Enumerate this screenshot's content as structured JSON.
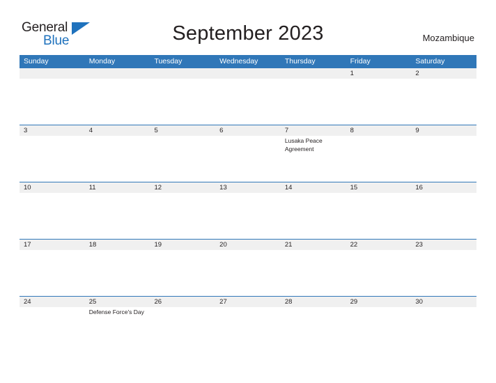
{
  "brand": {
    "name_part1": "General",
    "name_part2": "Blue",
    "logo_icon": "triangle-icon",
    "accent_color": "#1f72bd"
  },
  "header": {
    "title": "September 2023",
    "country": "Mozambique"
  },
  "calendar": {
    "header_bg_color": "#3077b8",
    "date_row_bg_color": "#f0f0f0",
    "day_names": [
      "Sunday",
      "Monday",
      "Tuesday",
      "Wednesday",
      "Thursday",
      "Friday",
      "Saturday"
    ],
    "weeks": [
      {
        "dates": [
          "",
          "",
          "",
          "",
          "",
          "1",
          "2"
        ],
        "events": [
          "",
          "",
          "",
          "",
          "",
          "",
          ""
        ]
      },
      {
        "dates": [
          "3",
          "4",
          "5",
          "6",
          "7",
          "8",
          "9"
        ],
        "events": [
          "",
          "",
          "",
          "",
          "Lusaka Peace Agreement",
          "",
          ""
        ]
      },
      {
        "dates": [
          "10",
          "11",
          "12",
          "13",
          "14",
          "15",
          "16"
        ],
        "events": [
          "",
          "",
          "",
          "",
          "",
          "",
          ""
        ]
      },
      {
        "dates": [
          "17",
          "18",
          "19",
          "20",
          "21",
          "22",
          "23"
        ],
        "events": [
          "",
          "",
          "",
          "",
          "",
          "",
          ""
        ]
      },
      {
        "dates": [
          "24",
          "25",
          "26",
          "27",
          "28",
          "29",
          "30"
        ],
        "events": [
          "",
          "Defense Force's Day",
          "",
          "",
          "",
          "",
          ""
        ]
      }
    ]
  }
}
